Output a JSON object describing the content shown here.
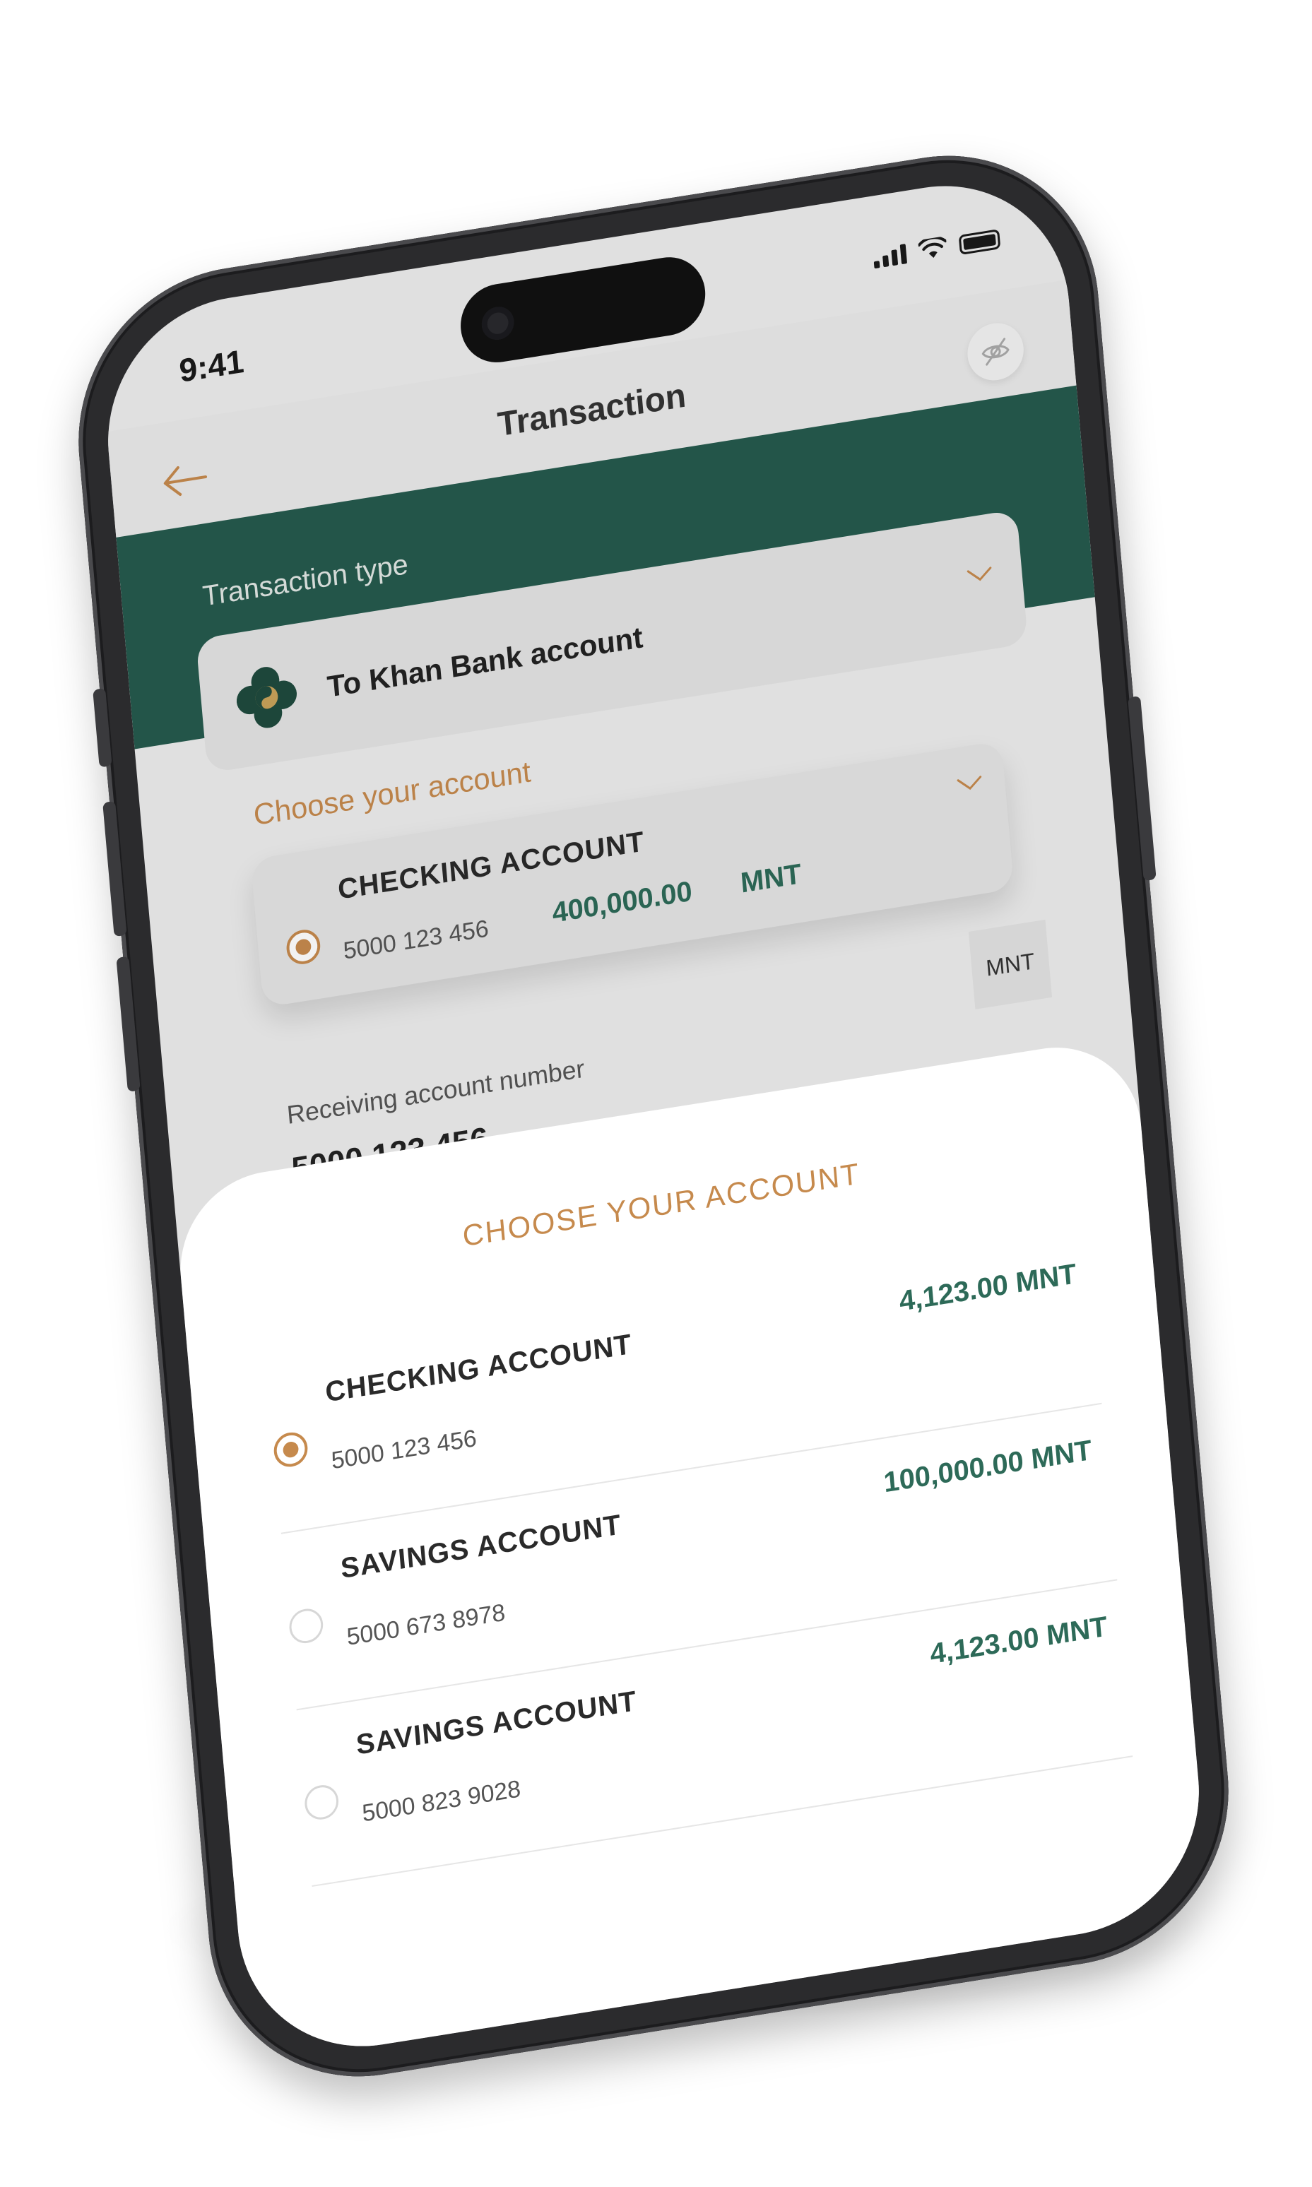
{
  "status_bar": {
    "time": "9:41"
  },
  "header": {
    "title": "Transaction",
    "back_icon": "arrow-left-icon",
    "privacy_icon": "eye-off-icon"
  },
  "transaction_type": {
    "label": "Transaction type",
    "selected": "To Khan Bank account",
    "logo_icon": "khan-bank-logo"
  },
  "account_section": {
    "label": "Choose your account",
    "selected": {
      "name": "CHECKING ACCOUNT",
      "number": "5000 123 456",
      "balance": "400,000.00",
      "currency": "MNT"
    }
  },
  "receiving": {
    "label": "Receiving account number",
    "value": "5000 123 456",
    "currency_chip": "MNT"
  },
  "sheet": {
    "title": "CHOOSE YOUR ACCOUNT",
    "accounts": [
      {
        "name": "CHECKING ACCOUNT",
        "number": "5000 123 456",
        "balance": "4,123.00 MNT",
        "selected": true
      },
      {
        "name": "SAVINGS ACCOUNT",
        "number": "5000 673 8978",
        "balance": "100,000.00 MNT",
        "selected": false
      },
      {
        "name": "SAVINGS ACCOUNT",
        "number": "5000 823 9028",
        "balance": "4,123.00 MNT",
        "selected": false
      }
    ]
  },
  "colors": {
    "accent": "#c68a4d",
    "brand_green": "#255a4d",
    "balance_green": "#2d6a58",
    "phone_frame": "#2b2b2d"
  }
}
